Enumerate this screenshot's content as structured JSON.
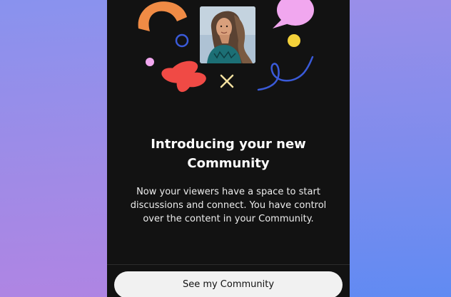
{
  "dialog": {
    "title_line1": "Introducing your new",
    "title_line2": "Community",
    "body_line1": "Now your viewers have a space to start",
    "body_line2": "discussions and connect. You have control",
    "body_line3": "over the content in your Community.",
    "cta_label": "See my Community"
  },
  "decorations": {
    "icons": [
      "orange-arc-shape",
      "pink-speech-bubble-shape",
      "blue-ring-shape",
      "yellow-dot-shape",
      "lilac-dot-shape",
      "red-flower-shape",
      "yellow-x-shape",
      "blue-squiggle-shape"
    ]
  },
  "colors": {
    "panel_background": "#121212",
    "orange": "#f08b45",
    "pink": "#f1a7ef",
    "blue": "#3a5ad8",
    "yellow": "#f4d13a",
    "red": "#f04a45",
    "button_background": "#f1f1f1"
  }
}
